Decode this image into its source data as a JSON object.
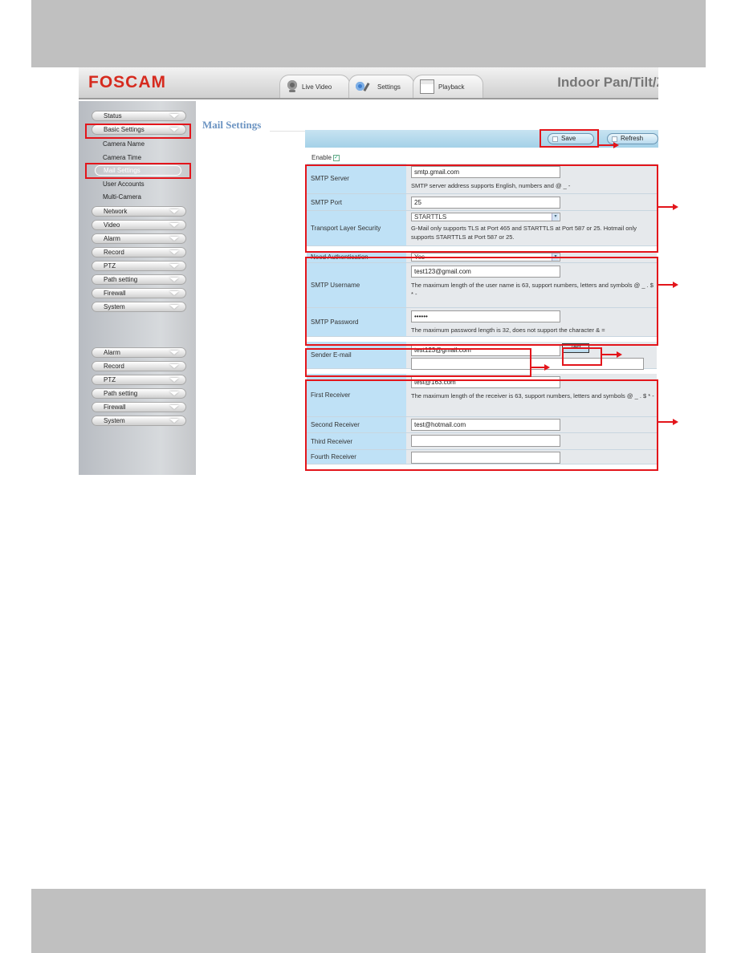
{
  "app": {
    "brand": "FOSCAM",
    "product_title": "Indoor Pan/Tilt/Z"
  },
  "tabs": [
    {
      "label": "Live Video",
      "icon": "webcam-icon"
    },
    {
      "label": "Settings",
      "icon": "gears-icon"
    },
    {
      "label": "Playback",
      "icon": "calendar-icon"
    }
  ],
  "sidebar": {
    "top": [
      {
        "label": "Status"
      },
      {
        "label": "Basic Settings"
      }
    ],
    "basic_settings_items": [
      {
        "label": "Camera Name"
      },
      {
        "label": "Camera Time"
      },
      {
        "label": "Mail Settings",
        "active": true
      },
      {
        "label": "User Accounts"
      },
      {
        "label": "Multi-Camera"
      }
    ],
    "groups": [
      {
        "label": "Network"
      },
      {
        "label": "Video"
      },
      {
        "label": "Alarm"
      },
      {
        "label": "Record"
      },
      {
        "label": "PTZ"
      },
      {
        "label": "Path setting"
      },
      {
        "label": "Firewall"
      },
      {
        "label": "System"
      }
    ],
    "groups_lower": [
      {
        "label": "Alarm"
      },
      {
        "label": "Record"
      },
      {
        "label": "PTZ"
      },
      {
        "label": "Path setting"
      },
      {
        "label": "Firewall"
      },
      {
        "label": "System"
      }
    ]
  },
  "page": {
    "title": "Mail Settings",
    "toolbar": {
      "save": "Save",
      "refresh": "Refresh"
    },
    "enable_label": "Enable",
    "enable_checked": true
  },
  "form": {
    "smtp_server": {
      "label": "SMTP Server",
      "value": "smtp.gmail.com",
      "note": "SMTP server address supports English, numbers and @ _ -"
    },
    "smtp_port": {
      "label": "SMTP Port",
      "value": "25"
    },
    "tls": {
      "label": "Transport Layer Security",
      "value": "STARTTLS",
      "note": "G-Mail only supports TLS at Port 465 and STARTTLS at Port 587 or 25. Hotmail only supports STARTTLS at Port 587 or 25."
    },
    "need_auth": {
      "label": "Need Authentication",
      "value": "Yes"
    },
    "smtp_username": {
      "label": "SMTP Username",
      "value": "test123@gmail.com",
      "note": "The maximum length of the user name is 63, support numbers, letters and symbols @ _ . $ * -"
    },
    "smtp_password": {
      "label": "SMTP Password",
      "value": "••••••",
      "note": "The maximum password length is 32, does not support the character & ="
    },
    "sender_email": {
      "label": "Sender E-mail",
      "value": "test123@gmail.com",
      "test_label": "Test",
      "test_result": ""
    },
    "first_receiver": {
      "label": "First Receiver",
      "value": "test@163.com",
      "note": "The maximum length of the receiver is 63, support numbers, letters and symbols @ _ . $ * -"
    },
    "second_receiver": {
      "label": "Second Receiver",
      "value": "test@hotmail.com"
    },
    "third_receiver": {
      "label": "Third Receiver",
      "value": ""
    },
    "fourth_receiver": {
      "label": "Fourth Receiver",
      "value": ""
    }
  },
  "colors": {
    "annotation_red": "#e3151b",
    "brand_red": "#d62a1e",
    "label_blue": "#bfe1f6",
    "title_blue": "#6c94c2"
  }
}
